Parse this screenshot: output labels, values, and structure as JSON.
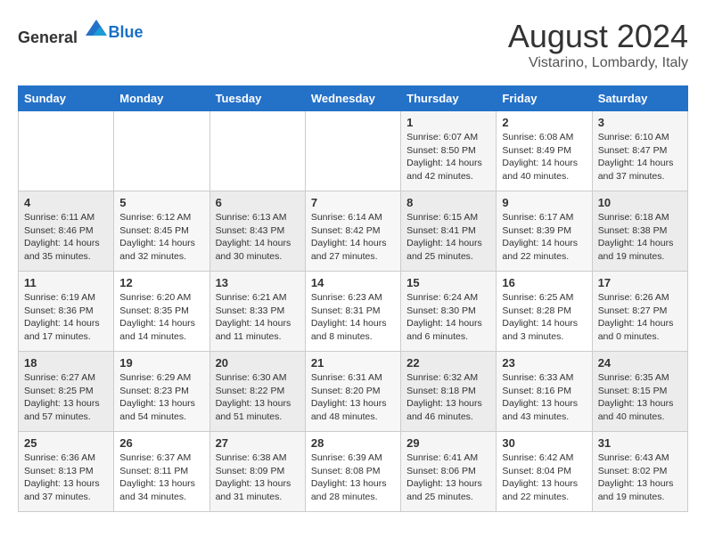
{
  "header": {
    "logo_general": "General",
    "logo_blue": "Blue",
    "month_year": "August 2024",
    "location": "Vistarino, Lombardy, Italy"
  },
  "days_of_week": [
    "Sunday",
    "Monday",
    "Tuesday",
    "Wednesday",
    "Thursday",
    "Friday",
    "Saturday"
  ],
  "weeks": [
    [
      {
        "day": "",
        "info": ""
      },
      {
        "day": "",
        "info": ""
      },
      {
        "day": "",
        "info": ""
      },
      {
        "day": "",
        "info": ""
      },
      {
        "day": "1",
        "info": "Sunrise: 6:07 AM\nSunset: 8:50 PM\nDaylight: 14 hours\nand 42 minutes."
      },
      {
        "day": "2",
        "info": "Sunrise: 6:08 AM\nSunset: 8:49 PM\nDaylight: 14 hours\nand 40 minutes."
      },
      {
        "day": "3",
        "info": "Sunrise: 6:10 AM\nSunset: 8:47 PM\nDaylight: 14 hours\nand 37 minutes."
      }
    ],
    [
      {
        "day": "4",
        "info": "Sunrise: 6:11 AM\nSunset: 8:46 PM\nDaylight: 14 hours\nand 35 minutes."
      },
      {
        "day": "5",
        "info": "Sunrise: 6:12 AM\nSunset: 8:45 PM\nDaylight: 14 hours\nand 32 minutes."
      },
      {
        "day": "6",
        "info": "Sunrise: 6:13 AM\nSunset: 8:43 PM\nDaylight: 14 hours\nand 30 minutes."
      },
      {
        "day": "7",
        "info": "Sunrise: 6:14 AM\nSunset: 8:42 PM\nDaylight: 14 hours\nand 27 minutes."
      },
      {
        "day": "8",
        "info": "Sunrise: 6:15 AM\nSunset: 8:41 PM\nDaylight: 14 hours\nand 25 minutes."
      },
      {
        "day": "9",
        "info": "Sunrise: 6:17 AM\nSunset: 8:39 PM\nDaylight: 14 hours\nand 22 minutes."
      },
      {
        "day": "10",
        "info": "Sunrise: 6:18 AM\nSunset: 8:38 PM\nDaylight: 14 hours\nand 19 minutes."
      }
    ],
    [
      {
        "day": "11",
        "info": "Sunrise: 6:19 AM\nSunset: 8:36 PM\nDaylight: 14 hours\nand 17 minutes."
      },
      {
        "day": "12",
        "info": "Sunrise: 6:20 AM\nSunset: 8:35 PM\nDaylight: 14 hours\nand 14 minutes."
      },
      {
        "day": "13",
        "info": "Sunrise: 6:21 AM\nSunset: 8:33 PM\nDaylight: 14 hours\nand 11 minutes."
      },
      {
        "day": "14",
        "info": "Sunrise: 6:23 AM\nSunset: 8:31 PM\nDaylight: 14 hours\nand 8 minutes."
      },
      {
        "day": "15",
        "info": "Sunrise: 6:24 AM\nSunset: 8:30 PM\nDaylight: 14 hours\nand 6 minutes."
      },
      {
        "day": "16",
        "info": "Sunrise: 6:25 AM\nSunset: 8:28 PM\nDaylight: 14 hours\nand 3 minutes."
      },
      {
        "day": "17",
        "info": "Sunrise: 6:26 AM\nSunset: 8:27 PM\nDaylight: 14 hours\nand 0 minutes."
      }
    ],
    [
      {
        "day": "18",
        "info": "Sunrise: 6:27 AM\nSunset: 8:25 PM\nDaylight: 13 hours\nand 57 minutes."
      },
      {
        "day": "19",
        "info": "Sunrise: 6:29 AM\nSunset: 8:23 PM\nDaylight: 13 hours\nand 54 minutes."
      },
      {
        "day": "20",
        "info": "Sunrise: 6:30 AM\nSunset: 8:22 PM\nDaylight: 13 hours\nand 51 minutes."
      },
      {
        "day": "21",
        "info": "Sunrise: 6:31 AM\nSunset: 8:20 PM\nDaylight: 13 hours\nand 48 minutes."
      },
      {
        "day": "22",
        "info": "Sunrise: 6:32 AM\nSunset: 8:18 PM\nDaylight: 13 hours\nand 46 minutes."
      },
      {
        "day": "23",
        "info": "Sunrise: 6:33 AM\nSunset: 8:16 PM\nDaylight: 13 hours\nand 43 minutes."
      },
      {
        "day": "24",
        "info": "Sunrise: 6:35 AM\nSunset: 8:15 PM\nDaylight: 13 hours\nand 40 minutes."
      }
    ],
    [
      {
        "day": "25",
        "info": "Sunrise: 6:36 AM\nSunset: 8:13 PM\nDaylight: 13 hours\nand 37 minutes."
      },
      {
        "day": "26",
        "info": "Sunrise: 6:37 AM\nSunset: 8:11 PM\nDaylight: 13 hours\nand 34 minutes."
      },
      {
        "day": "27",
        "info": "Sunrise: 6:38 AM\nSunset: 8:09 PM\nDaylight: 13 hours\nand 31 minutes."
      },
      {
        "day": "28",
        "info": "Sunrise: 6:39 AM\nSunset: 8:08 PM\nDaylight: 13 hours\nand 28 minutes."
      },
      {
        "day": "29",
        "info": "Sunrise: 6:41 AM\nSunset: 8:06 PM\nDaylight: 13 hours\nand 25 minutes."
      },
      {
        "day": "30",
        "info": "Sunrise: 6:42 AM\nSunset: 8:04 PM\nDaylight: 13 hours\nand 22 minutes."
      },
      {
        "day": "31",
        "info": "Sunrise: 6:43 AM\nSunset: 8:02 PM\nDaylight: 13 hours\nand 19 minutes."
      }
    ]
  ]
}
